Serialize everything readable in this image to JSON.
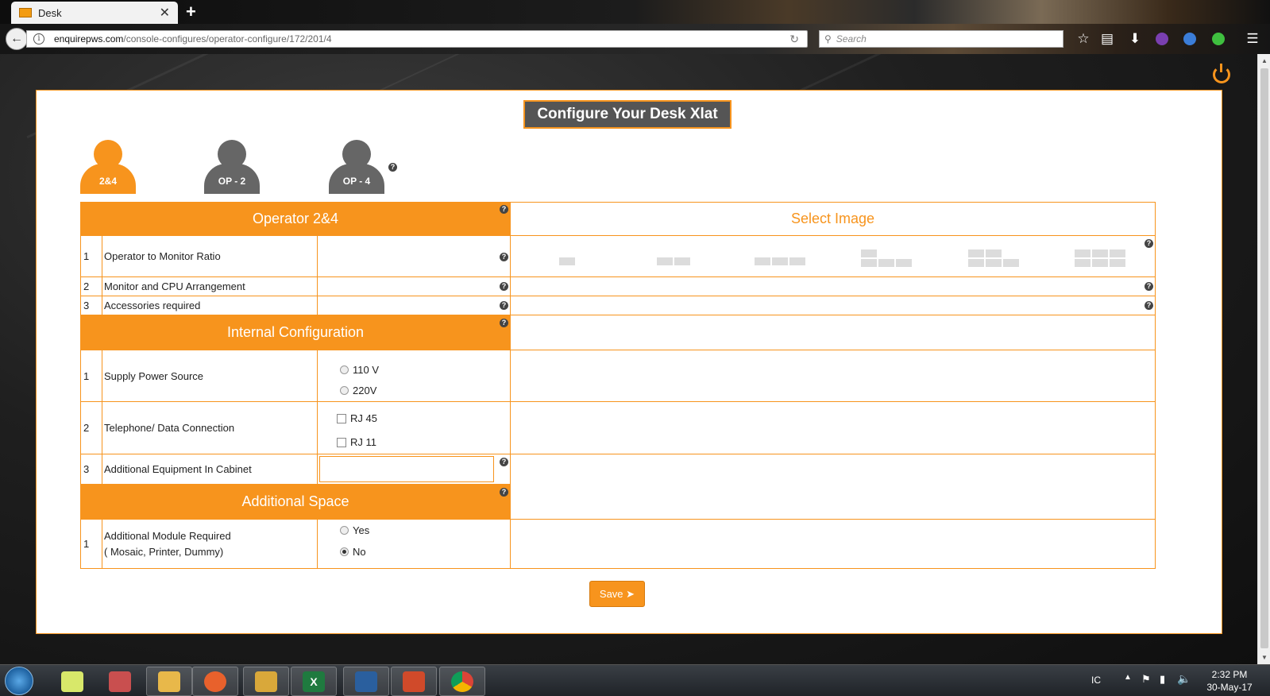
{
  "browser": {
    "tab_title": "Desk",
    "tab_close": "✕",
    "new_tab": "+",
    "url_host": "enquirepws.com",
    "url_path": "/console-configures/operator-configure/172/201/4",
    "search_placeholder": "Search"
  },
  "page": {
    "title": "Configure Your Desk Xlat",
    "operators": [
      {
        "label": "2&4",
        "active": true
      },
      {
        "label": "OP - 2",
        "active": false
      },
      {
        "label": "OP - 4",
        "active": false
      }
    ],
    "left_header": "Operator 2&4",
    "right_header": "Select Image",
    "section1_rows": [
      {
        "num": "1",
        "label": "Operator to Monitor Ratio"
      },
      {
        "num": "2",
        "label": "Monitor and CPU Arrangement"
      },
      {
        "num": "3",
        "label": "Accessories required"
      }
    ],
    "internal_header": "Internal Configuration",
    "internal_rows": [
      {
        "num": "1",
        "label": "Supply Power Source",
        "options": [
          "110 V",
          "220V"
        ]
      },
      {
        "num": "2",
        "label": "Telephone/ Data Connection",
        "options": [
          "RJ 45",
          "RJ 11"
        ]
      },
      {
        "num": "3",
        "label": "Additional Equipment In Cabinet"
      }
    ],
    "additional_header": "Additional Space",
    "additional_row": {
      "num": "1",
      "label_line1": "Additional Module Required",
      "label_line2": "( Mosaic, Printer, Dummy)",
      "options": [
        "Yes",
        "No"
      ],
      "selected": "No"
    },
    "save_label": "Save",
    "help_glyph": "?"
  },
  "taskbar": {
    "lang": "IC",
    "time": "2:32 PM",
    "date": "30-May-17"
  },
  "colors": {
    "accent": "#f7941d",
    "title_bg": "#555555",
    "inactive_operator": "#666666"
  },
  "icons": [
    "back-arrow-icon",
    "info-icon",
    "reload-icon",
    "search-icon",
    "bookmark-star-icon",
    "reading-list-icon",
    "download-icon",
    "menu-icon",
    "power-icon",
    "help-icon",
    "operator-icon",
    "save-arrow-icon"
  ]
}
